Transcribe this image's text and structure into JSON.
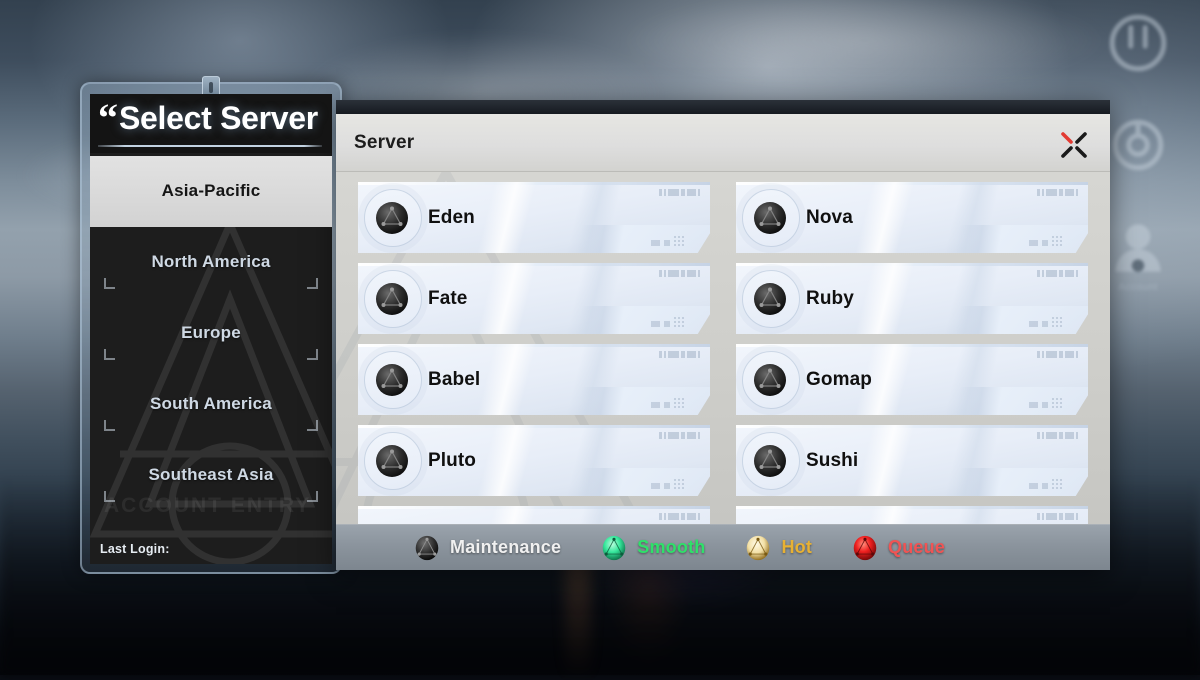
{
  "background": {
    "nav_icons": [
      {
        "name": "power-icon",
        "label": ""
      },
      {
        "name": "settings-icon",
        "label": ""
      },
      {
        "name": "account-icon",
        "label": "Account"
      }
    ]
  },
  "left_panel": {
    "quote_mark": "“",
    "title": "Select Server",
    "watermark_text": "ACCOUNT ENTRY",
    "regions": [
      {
        "label": "Asia-Pacific",
        "selected": true
      },
      {
        "label": "North America",
        "selected": false
      },
      {
        "label": "Europe",
        "selected": false
      },
      {
        "label": "South America",
        "selected": false
      },
      {
        "label": "Southeast Asia",
        "selected": false
      }
    ],
    "last_login_label": "Last Login:"
  },
  "dialog": {
    "title": "Server",
    "close_label": "Close",
    "close_accent_color": "#e23b33",
    "close_stroke_color": "#1a1a1a"
  },
  "servers": [
    {
      "name": "Eden",
      "status": "maintenance"
    },
    {
      "name": "Nova",
      "status": "maintenance"
    },
    {
      "name": "Fate",
      "status": "maintenance"
    },
    {
      "name": "Ruby",
      "status": "maintenance"
    },
    {
      "name": "Babel",
      "status": "maintenance"
    },
    {
      "name": "Gomap",
      "status": "maintenance"
    },
    {
      "name": "Pluto",
      "status": "maintenance"
    },
    {
      "name": "Sushi",
      "status": "maintenance"
    }
  ],
  "legend": [
    {
      "label": "Maintenance",
      "color": "#3a3a3a",
      "text_color": "#f0f0f0"
    },
    {
      "label": "Smooth",
      "color": "#2fe08a",
      "text_color": "#2fe06a"
    },
    {
      "label": "Hot",
      "color": "#f7e3a0",
      "text_color": "#e8b133"
    },
    {
      "label": "Queue",
      "color": "#ef2b2b",
      "text_color": "#f05454"
    }
  ]
}
